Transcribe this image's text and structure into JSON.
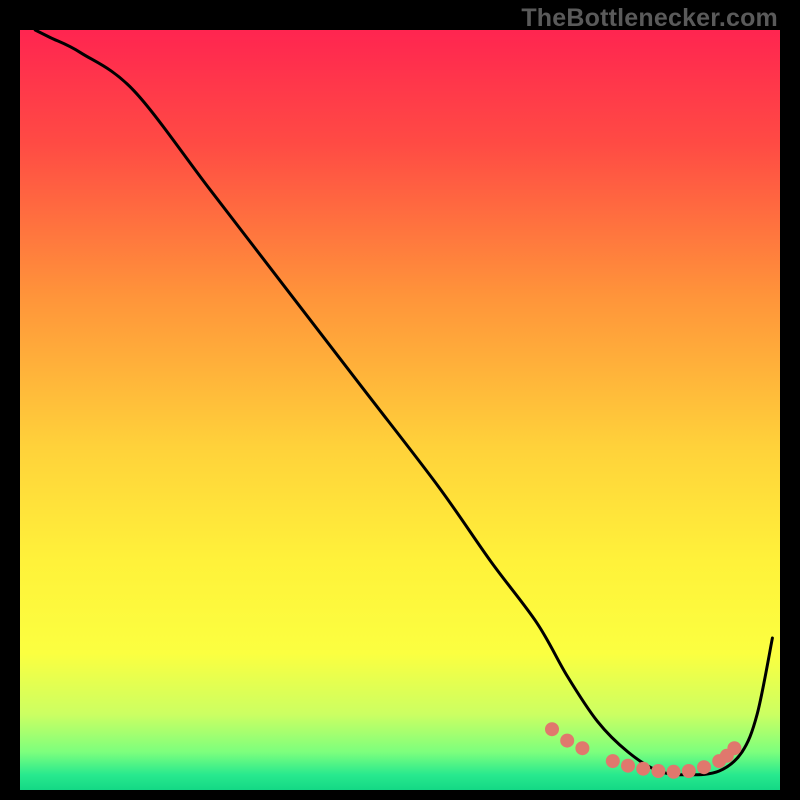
{
  "watermark": "TheBottlenecker.com",
  "gradient": {
    "stops": [
      {
        "offset": 0.0,
        "color": "#ff2550"
      },
      {
        "offset": 0.15,
        "color": "#ff4b44"
      },
      {
        "offset": 0.35,
        "color": "#ff943a"
      },
      {
        "offset": 0.55,
        "color": "#ffd23a"
      },
      {
        "offset": 0.7,
        "color": "#fff23a"
      },
      {
        "offset": 0.82,
        "color": "#fbff40"
      },
      {
        "offset": 0.9,
        "color": "#ccff62"
      },
      {
        "offset": 0.95,
        "color": "#7dff7d"
      },
      {
        "offset": 0.98,
        "color": "#28e98e"
      },
      {
        "offset": 1.0,
        "color": "#14d885"
      }
    ]
  },
  "chart_data": {
    "type": "line",
    "title": "",
    "xlabel": "",
    "ylabel": "",
    "xlim": [
      0,
      100
    ],
    "ylim": [
      0,
      100
    ],
    "series": [
      {
        "name": "curve",
        "x": [
          2,
          4,
          8,
          15,
          25,
          35,
          45,
          55,
          62,
          68,
          72,
          76,
          80,
          84,
          88,
          92,
          95,
          97,
          99
        ],
        "y": [
          100,
          99,
          97,
          92,
          79,
          66,
          53,
          40,
          30,
          22,
          15,
          9,
          5,
          2.5,
          2,
          2.5,
          5,
          10,
          20
        ]
      }
    ],
    "markers": {
      "name": "dots",
      "x": [
        70,
        72,
        74,
        78,
        80,
        82,
        84,
        86,
        88,
        90,
        92,
        93,
        94
      ],
      "y": [
        8,
        6.5,
        5.5,
        3.8,
        3.2,
        2.8,
        2.5,
        2.4,
        2.5,
        3.0,
        3.8,
        4.5,
        5.5
      ]
    }
  }
}
